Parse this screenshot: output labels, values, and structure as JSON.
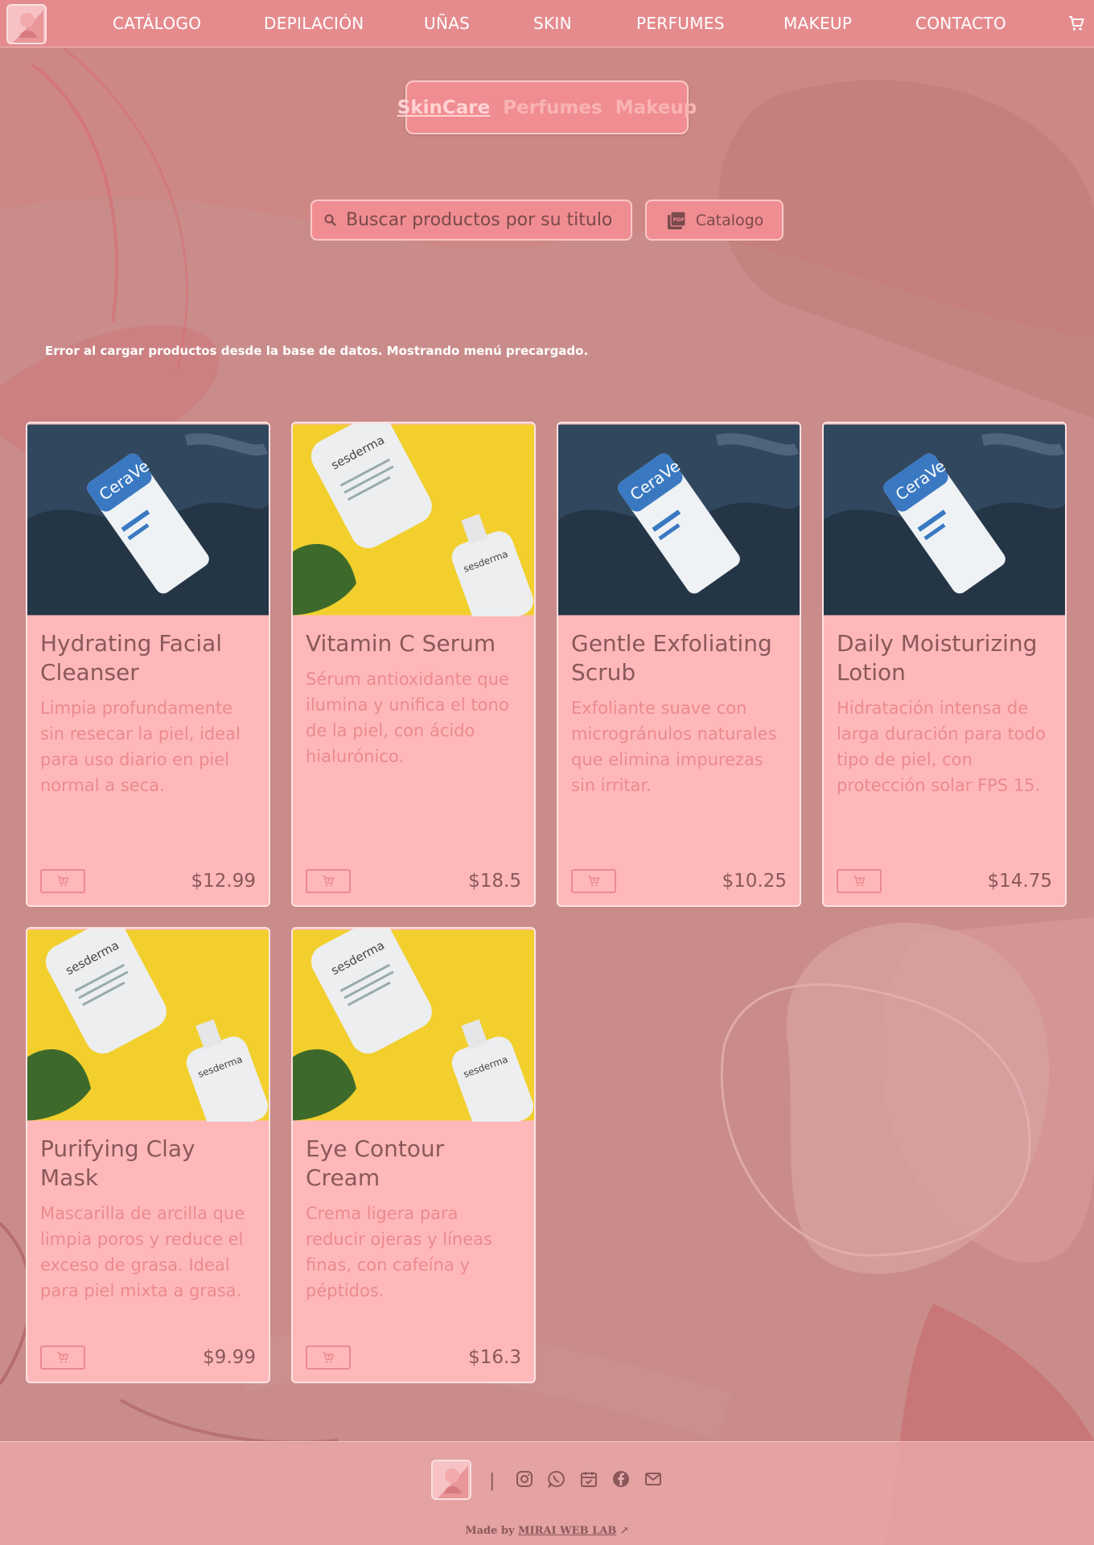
{
  "nav": {
    "links": [
      "CATÁLOGO",
      "DEPILACIÓN",
      "UÑAS",
      "SKIN",
      "PERFUMES",
      "MAKEUP",
      "CONTACTO"
    ],
    "cart_icon": "cart-icon"
  },
  "categories": {
    "tabs": [
      "SkinCare",
      "Perfumes",
      "Makeup"
    ],
    "active": "SkinCare"
  },
  "search": {
    "placeholder": "Buscar productos por su titulo",
    "value": ""
  },
  "catalog_button": {
    "label": "Catalogo",
    "icon": "pdf-icon"
  },
  "error_message": "Error al cargar productos desde la base de datos. Mostrando menú precargado.",
  "products": [
    {
      "title": "Hydrating Facial Cleanser",
      "description": "Limpia profundamente sin resecar la piel, ideal para uso diario en piel normal a seca.",
      "price": "$12.99",
      "image": "blue-tube"
    },
    {
      "title": "Vitamin C Serum",
      "description": "Sérum antioxidante que ilumina y unifica el tono de la piel, con ácido hialurónico.",
      "price": "$18.5",
      "image": "yellow-bottles"
    },
    {
      "title": "Gentle Exfoliating Scrub",
      "description": "Exfoliante suave con microgránulos naturales que elimina impurezas sin irritar.",
      "price": "$10.25",
      "image": "blue-tube"
    },
    {
      "title": "Daily Moisturizing Lotion",
      "description": "Hidratación intensa de larga duración para todo tipo de piel, con protección solar FPS 15.",
      "price": "$14.75",
      "image": "blue-tube"
    },
    {
      "title": "Purifying Clay Mask",
      "description": "Mascarilla de arcilla que limpia poros y reduce el exceso de grasa. Ideal para piel mixta a grasa.",
      "price": "$9.99",
      "image": "yellow-bottles"
    },
    {
      "title": "Eye Contour Cream",
      "description": "Crema ligera para reducir ojeras y líneas finas, con cafeína y péptidos.",
      "price": "$16.3",
      "image": "yellow-bottles"
    }
  ],
  "footer": {
    "separator": "|",
    "socials": [
      "instagram-icon",
      "whatsapp-icon",
      "calendar-icon",
      "facebook-icon",
      "mail-icon"
    ],
    "made_by_prefix": "Made by",
    "made_by_name": "MIRAI WEB LAB",
    "made_by_arrow": "↗"
  },
  "colors": {
    "nav": "#e58b8e",
    "card": "#ffb8ba",
    "accent": "#f08d92",
    "background": "#c98c8a"
  }
}
